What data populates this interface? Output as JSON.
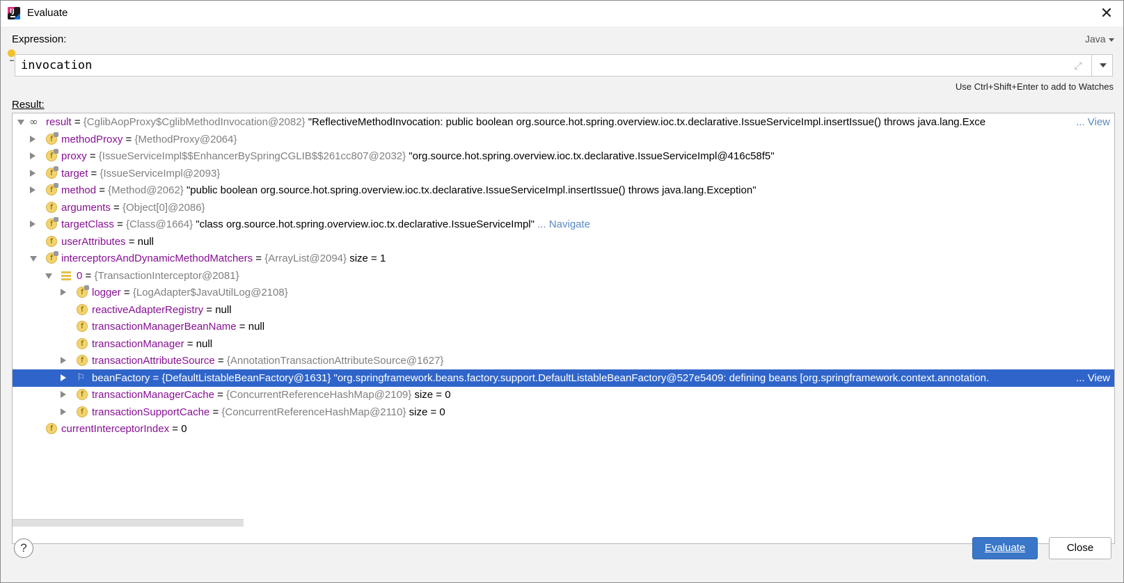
{
  "window": {
    "title": "Evaluate",
    "close_glyph": "✕"
  },
  "expression": {
    "label": "Expression:",
    "language": "Java",
    "value": "invocation",
    "hint": "Use Ctrl+Shift+Enter to add to Watches"
  },
  "result": {
    "label": "Result:",
    "rows": [
      {
        "name": "result",
        "eq": " = ",
        "type": "{CglibAopProxy$CglibMethodInvocation@2082}",
        "value": " \"ReflectiveMethodInvocation: public boolean org.source.hot.spring.overview.ioc.tx.declarative.IssueServiceImpl.insertIssue() throws java.lang.Exce",
        "link": "... View"
      },
      {
        "name": "methodProxy",
        "eq": " = ",
        "type": "{MethodProxy@2064}",
        "value": "",
        "link": ""
      },
      {
        "name": "proxy",
        "eq": " = ",
        "type": "{IssueServiceImpl$$EnhancerBySpringCGLIB$$261cc807@2032}",
        "value": " \"org.source.hot.spring.overview.ioc.tx.declarative.IssueServiceImpl@416c58f5\"",
        "link": ""
      },
      {
        "name": "target",
        "eq": " = ",
        "type": "{IssueServiceImpl@2093}",
        "value": "",
        "link": ""
      },
      {
        "name": "method",
        "eq": " = ",
        "type": "{Method@2062}",
        "value": " \"public boolean org.source.hot.spring.overview.ioc.tx.declarative.IssueServiceImpl.insertIssue() throws java.lang.Exception\"",
        "link": ""
      },
      {
        "name": "arguments",
        "eq": " = ",
        "type": "{Object[0]@2086}",
        "value": "",
        "link": ""
      },
      {
        "name": "targetClass",
        "eq": " = ",
        "type": "{Class@1664}",
        "value": " \"class org.source.hot.spring.overview.ioc.tx.declarative.IssueServiceImpl\"",
        "link": " ... Navigate"
      },
      {
        "name": "userAttributes",
        "eq": " = ",
        "type": "",
        "value": "null",
        "link": ""
      },
      {
        "name": "interceptorsAndDynamicMethodMatchers",
        "eq": " = ",
        "type": "{ArrayList@2094}",
        "value": "  size = 1",
        "link": ""
      },
      {
        "name": "0",
        "eq": " = ",
        "type": "{TransactionInterceptor@2081}",
        "value": "",
        "link": ""
      },
      {
        "name": "logger",
        "eq": " = ",
        "type": "{LogAdapter$JavaUtilLog@2108}",
        "value": "",
        "link": ""
      },
      {
        "name": "reactiveAdapterRegistry",
        "eq": " = ",
        "type": "",
        "value": "null",
        "link": ""
      },
      {
        "name": "transactionManagerBeanName",
        "eq": " = ",
        "type": "",
        "value": "null",
        "link": ""
      },
      {
        "name": "transactionManager",
        "eq": " = ",
        "type": "",
        "value": "null",
        "link": ""
      },
      {
        "name": "transactionAttributeSource",
        "eq": " = ",
        "type": "{AnnotationTransactionAttributeSource@1627}",
        "value": "",
        "link": ""
      },
      {
        "name": "beanFactory",
        "eq": " = ",
        "type": "{DefaultListableBeanFactory@1631}",
        "value": " \"org.springframework.beans.factory.support.DefaultListableBeanFactory@527e5409: defining beans [org.springframework.context.annotation.",
        "link": "... View"
      },
      {
        "name": "transactionManagerCache",
        "eq": " = ",
        "type": "{ConcurrentReferenceHashMap@2109}",
        "value": "  size = 0",
        "link": ""
      },
      {
        "name": "transactionSupportCache",
        "eq": " = ",
        "type": "{ConcurrentReferenceHashMap@2110}",
        "value": "  size = 0",
        "link": ""
      },
      {
        "name": "currentInterceptorIndex",
        "eq": " = ",
        "type": "",
        "value": "0",
        "link": ""
      }
    ]
  },
  "buttons": {
    "help": "?",
    "evaluate": "Evaluate",
    "close": "Close"
  },
  "colors": {
    "selection": "#2f65ca",
    "primary_button": "#3a77c8",
    "field_name": "#871094",
    "type_gray": "#808080",
    "link": "#5a88c4"
  }
}
